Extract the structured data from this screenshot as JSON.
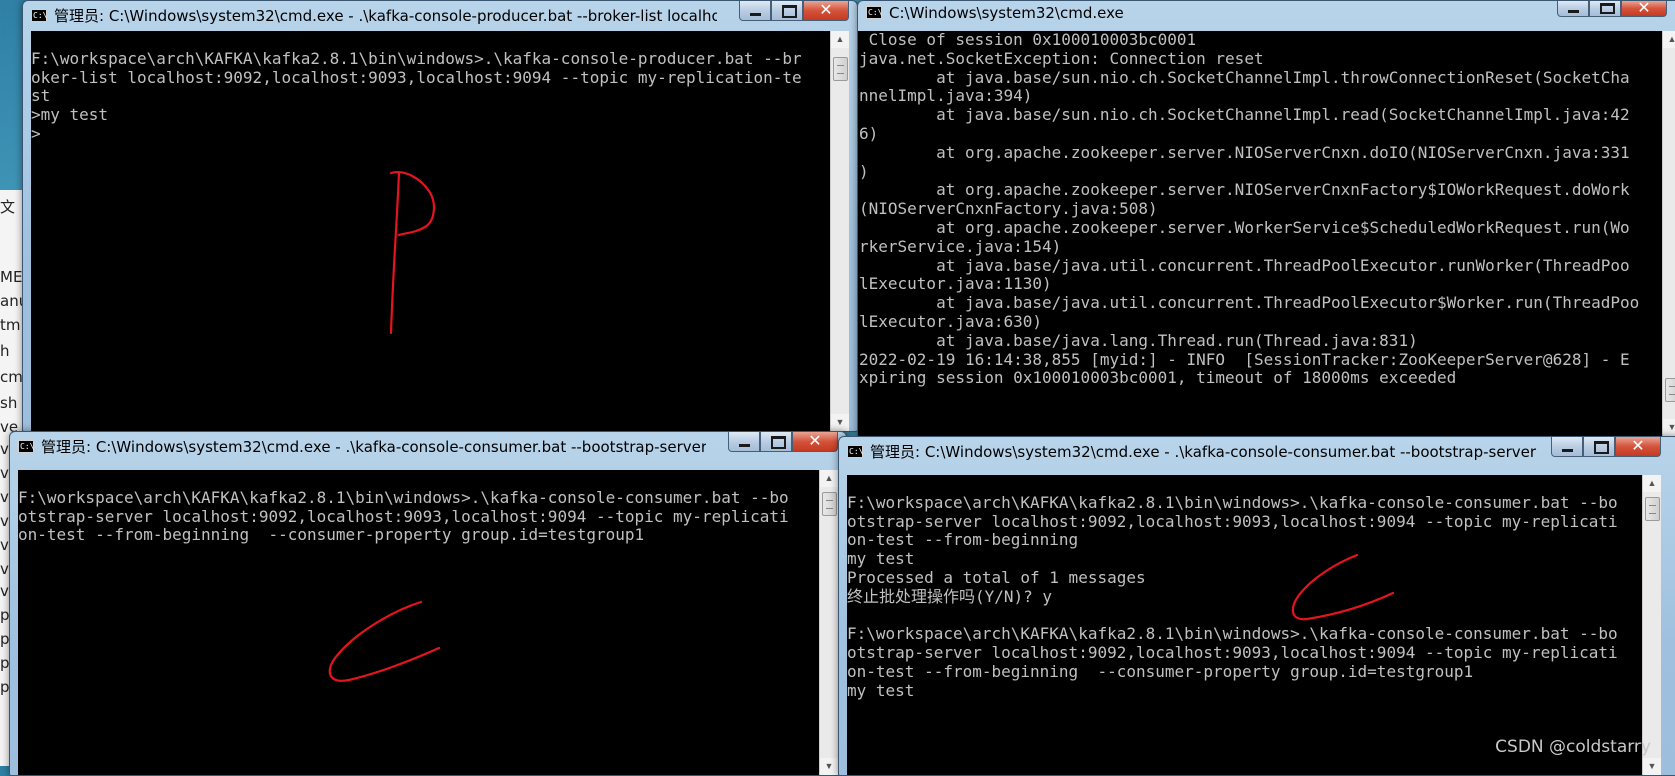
{
  "background_strip": {
    "items": [
      "文",
      "ME",
      "anu",
      "tm",
      "h",
      "cm",
      "sh",
      "ve",
      "ve",
      "ve",
      "ve",
      "ve",
      "ve",
      "ve",
      "ve",
      "p",
      "p",
      "p",
      "p"
    ]
  },
  "windows": {
    "producer": {
      "title": "管理员: C:\\Windows\\system32\\cmd.exe - .\\kafka-console-producer.bat  --broker-list localhos...",
      "lines": [
        "",
        "F:\\workspace\\arch\\KAFKA\\kafka2.8.1\\bin\\windows>.\\kafka-console-producer.bat --br",
        "oker-list localhost:9092,localhost:9093,localhost:9094 --topic my-replication-te",
        "st",
        ">my test",
        ">"
      ],
      "annotation": "P"
    },
    "zookeeper": {
      "title": "C:\\Windows\\system32\\cmd.exe",
      "lines": [
        " Close of session 0x100010003bc0001",
        "java.net.SocketException: Connection reset",
        "        at java.base/sun.nio.ch.SocketChannelImpl.throwConnectionReset(SocketCha",
        "nnelImpl.java:394)",
        "        at java.base/sun.nio.ch.SocketChannelImpl.read(SocketChannelImpl.java:42",
        "6)",
        "        at org.apache.zookeeper.server.NIOServerCnxn.doIO(NIOServerCnxn.java:331",
        ")",
        "        at org.apache.zookeeper.server.NIOServerCnxnFactory$IOWorkRequest.doWork",
        "(NIOServerCnxnFactory.java:508)",
        "        at org.apache.zookeeper.server.WorkerService$ScheduledWorkRequest.run(Wo",
        "rkerService.java:154)",
        "        at java.base/java.util.concurrent.ThreadPoolExecutor.runWorker(ThreadPoo",
        "lExecutor.java:1130)",
        "        at java.base/java.util.concurrent.ThreadPoolExecutor$Worker.run(ThreadPoo",
        "lExecutor.java:630)",
        "        at java.base/java.lang.Thread.run(Thread.java:831)",
        "2022-02-19 16:14:38,855 [myid:] - INFO  [SessionTracker:ZooKeeperServer@628] - E",
        "xpiring session 0x100010003bc0001, timeout of 18000ms exceeded"
      ]
    },
    "consumer_left": {
      "title": "管理员: C:\\Windows\\system32\\cmd.exe - .\\kafka-console-consumer.bat  --bootstrap-server l...",
      "lines": [
        "",
        "F:\\workspace\\arch\\KAFKA\\kafka2.8.1\\bin\\windows>.\\kafka-console-consumer.bat --bo",
        "otstrap-server localhost:9092,localhost:9093,localhost:9094 --topic my-replicati",
        "on-test --from-beginning  --consumer-property group.id=testgroup1"
      ],
      "annotation": "C"
    },
    "consumer_right": {
      "title": "管理员: C:\\Windows\\system32\\cmd.exe - .\\kafka-console-consumer.bat  --bootstrap-server l...",
      "lines": [
        "",
        "F:\\workspace\\arch\\KAFKA\\kafka2.8.1\\bin\\windows>.\\kafka-console-consumer.bat --bo",
        "otstrap-server localhost:9092,localhost:9093,localhost:9094 --topic my-replicati",
        "on-test --from-beginning",
        "my test",
        "Processed a total of 1 messages",
        "终止批处理操作吗(Y/N)? y",
        "",
        "F:\\workspace\\arch\\KAFKA\\kafka2.8.1\\bin\\windows>.\\kafka-console-consumer.bat --bo",
        "otstrap-server localhost:9092,localhost:9093,localhost:9094 --topic my-replicati",
        "on-test --from-beginning  --consumer-property group.id=testgroup1",
        "my test"
      ],
      "annotation": "C"
    }
  },
  "watermark": "CSDN @coldstarry",
  "colors": {
    "console_bg": "#000000",
    "console_text": "#c0c0c0",
    "annotation": "#e5141e"
  }
}
